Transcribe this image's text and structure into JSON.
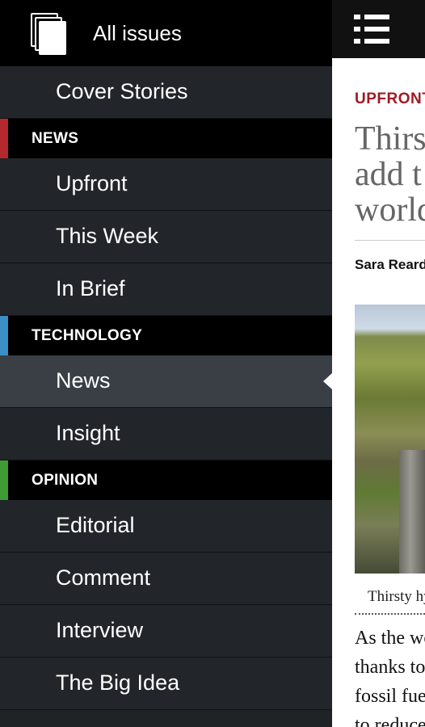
{
  "article": {
    "category": "UPFRONT",
    "title": "Thirsty\nadd t\nworld",
    "author": "Sara Reardon",
    "caption": "Thirsty hydro",
    "body": "As the world\nthanks to a\nfossil fuel\nto reduce"
  },
  "drawer": {
    "header_label": "All issues",
    "items": [
      {
        "kind": "item",
        "label": "Cover Stories"
      },
      {
        "kind": "section",
        "label": "NEWS",
        "color": "#b5282d"
      },
      {
        "kind": "item",
        "label": "Upfront"
      },
      {
        "kind": "item",
        "label": "This Week"
      },
      {
        "kind": "item",
        "label": "In Brief"
      },
      {
        "kind": "section",
        "label": "TECHNOLOGY",
        "color": "#3c8ec8"
      },
      {
        "kind": "item",
        "label": "News",
        "selected": true
      },
      {
        "kind": "item",
        "label": "Insight"
      },
      {
        "kind": "section",
        "label": "OPINION",
        "color": "#3f9c35"
      },
      {
        "kind": "item",
        "label": "Editorial"
      },
      {
        "kind": "item",
        "label": "Comment"
      },
      {
        "kind": "item",
        "label": "Interview"
      },
      {
        "kind": "item",
        "label": "The Big Idea"
      }
    ]
  },
  "icons": {
    "menu": "menu-list-icon",
    "issues": "issues-stack-icon",
    "selection": "selection-pointer-icon"
  }
}
